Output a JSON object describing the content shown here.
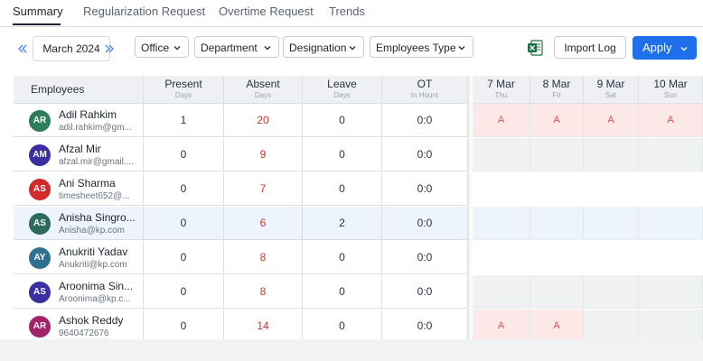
{
  "tabs": [
    {
      "label": "Summary",
      "active": true
    },
    {
      "label": "Regularization Request",
      "active": false
    },
    {
      "label": "Overtime Request",
      "active": false
    },
    {
      "label": "Trends",
      "active": false
    }
  ],
  "toolbar": {
    "month": "March 2024",
    "prev_icon": "double-chevron-left-icon",
    "next_icon": "double-chevron-right-icon",
    "filters": [
      "Office",
      "Department",
      "Designation",
      "Employees Type"
    ],
    "excel_icon": "excel-icon",
    "import_label": "Import Log",
    "apply_label": "Apply",
    "accent_color": "#1f6fec"
  },
  "table": {
    "headers": {
      "employees": "Employees",
      "present": {
        "label": "Present",
        "sub": "Days"
      },
      "absent": {
        "label": "Absent",
        "sub": "Days"
      },
      "leave": {
        "label": "Leave",
        "sub": "Days"
      },
      "ot": {
        "label": "OT",
        "sub": "In Hours"
      }
    },
    "days": [
      {
        "label": "7 Mar",
        "sub": "Thu"
      },
      {
        "label": "8 Mar",
        "sub": "Fri"
      },
      {
        "label": "9 Mar",
        "sub": "Sat"
      },
      {
        "label": "10 Mar",
        "sub": "Sun"
      }
    ],
    "rows": [
      {
        "initials": "AR",
        "avatar_color": "#2e7d5b",
        "name": "Adil Rahkim",
        "email": "adil.rahkim@gm...",
        "present": "1",
        "absent": "20",
        "leave": "0",
        "ot": "0:0",
        "days": [
          "A",
          "A",
          "A",
          "A"
        ],
        "day_bg": [
          "absent",
          "absent",
          "absent",
          "absent"
        ],
        "highlight": false
      },
      {
        "initials": "AM",
        "avatar_color": "#3b2fa3",
        "name": "Afzal Mir",
        "email": "afzal.mir@gmail....",
        "present": "0",
        "absent": "9",
        "leave": "0",
        "ot": "0:0",
        "days": [
          "",
          "",
          "",
          ""
        ],
        "day_bg": [
          "grey",
          "grey",
          "grey",
          "grey"
        ],
        "highlight": false
      },
      {
        "initials": "AS",
        "avatar_color": "#d12a2a",
        "name": "Ani Sharma",
        "email": "timesheet652@...",
        "present": "0",
        "absent": "7",
        "leave": "0",
        "ot": "0:0",
        "days": [
          "",
          "",
          "",
          ""
        ],
        "day_bg": [
          "none",
          "none",
          "none",
          "none"
        ],
        "highlight": false
      },
      {
        "initials": "AS",
        "avatar_color": "#2e6b5a",
        "name": "Anisha Singro...",
        "email": "Anisha@kp.com",
        "present": "0",
        "absent": "6",
        "leave": "2",
        "ot": "0:0",
        "days": [
          "",
          "",
          "",
          ""
        ],
        "day_bg": [
          "none",
          "none",
          "none",
          "none"
        ],
        "highlight": true
      },
      {
        "initials": "AY",
        "avatar_color": "#2f6f8f",
        "name": "Anukriti Yadav",
        "email": "Anukriti@kp.com",
        "present": "0",
        "absent": "8",
        "leave": "0",
        "ot": "0:0",
        "days": [
          "",
          "",
          "",
          ""
        ],
        "day_bg": [
          "none",
          "none",
          "none",
          "none"
        ],
        "highlight": false
      },
      {
        "initials": "AS",
        "avatar_color": "#3b2fa3",
        "name": "Aroonima Sin...",
        "email": "Aroonima@kp.c...",
        "present": "0",
        "absent": "8",
        "leave": "0",
        "ot": "0:0",
        "days": [
          "",
          "",
          "",
          ""
        ],
        "day_bg": [
          "grey",
          "grey",
          "grey",
          "grey"
        ],
        "highlight": false
      },
      {
        "initials": "AR",
        "avatar_color": "#a3236b",
        "name": "Ashok Reddy",
        "email": "9640472676",
        "present": "0",
        "absent": "14",
        "leave": "0",
        "ot": "0:0",
        "days": [
          "A",
          "A",
          "",
          ""
        ],
        "day_bg": [
          "absent",
          "absent",
          "grey",
          "grey"
        ],
        "highlight": false
      }
    ]
  }
}
